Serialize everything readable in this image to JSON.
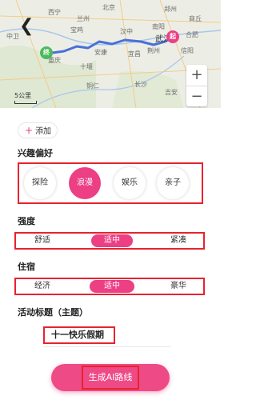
{
  "map": {
    "back_glyph": "❮",
    "labels": {
      "c1": "中卫",
      "c2": "宝鸡",
      "c3": "汉中",
      "c4": "重庆",
      "c5": "宜昌",
      "c6": "荆州",
      "c7": "武汉",
      "c8": "长沙",
      "c9": "商丘",
      "c10": "合肥",
      "c11": "铜仁",
      "c12": "郑州",
      "c13": "西宁",
      "c14": "兰州",
      "c15": "北京",
      "c16": "安康",
      "c17": "十堰",
      "c18": "南阳",
      "c19": "信阳",
      "c20": "吉安"
    },
    "start_pin": "终",
    "end_pin": "起",
    "zoom_in": "+",
    "zoom_out": "−",
    "scale": "5公里"
  },
  "add_button": {
    "plus": "+",
    "label": "添加"
  },
  "interest": {
    "title": "兴趣偏好",
    "options": [
      "探险",
      "浪漫",
      "娱乐",
      "亲子"
    ],
    "selected_index": 1
  },
  "intensity": {
    "title": "强度",
    "options": [
      "舒适",
      "适中",
      "紧凑"
    ],
    "selected_index": 1
  },
  "lodging": {
    "title": "住宿",
    "options": [
      "经济",
      "适中",
      "豪华"
    ],
    "selected_index": 1
  },
  "theme": {
    "title": "活动标题（主题）",
    "value": "十一快乐假期"
  },
  "generate_button": {
    "label": "生成AI路线"
  },
  "colors": {
    "accent": "#ec3f84",
    "highlight_border": "#e8222e",
    "route": "#4a6fd8",
    "start_pin": "#4cba5a",
    "end_pin": "#ec3f84"
  }
}
